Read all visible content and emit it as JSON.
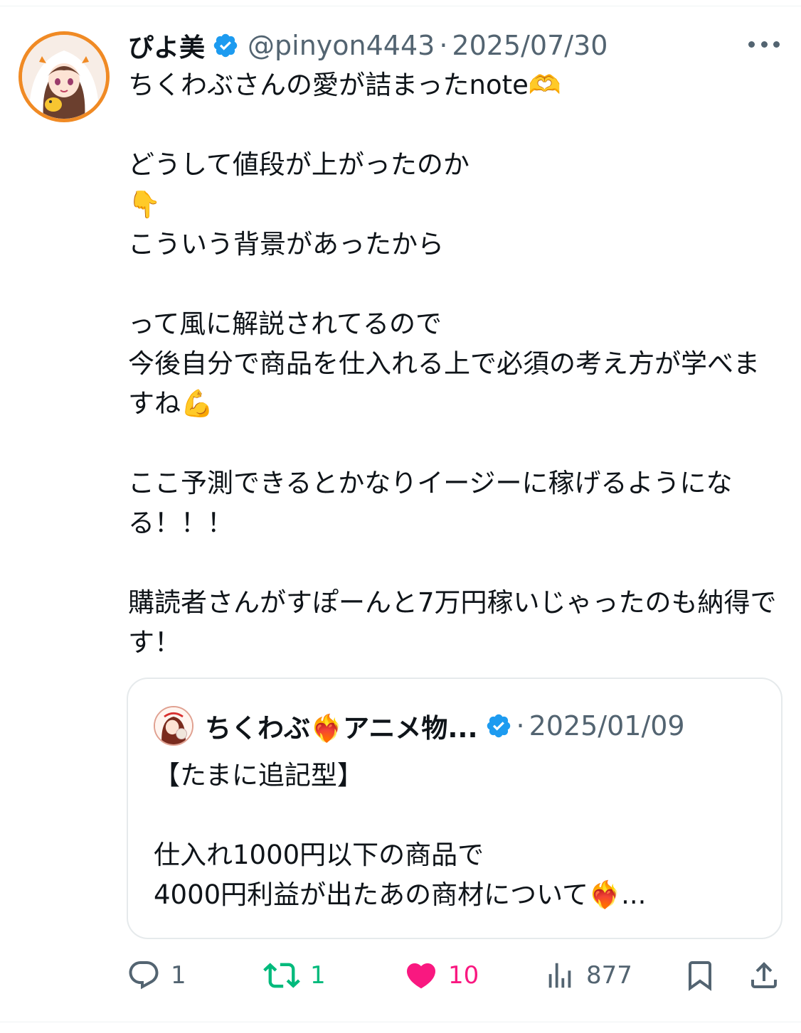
{
  "post": {
    "author": {
      "display_name": "ぴよ美",
      "handle": "@pinyon4443",
      "verified": true,
      "separator": "·",
      "date": "2025/07/30",
      "avatar_border_color": "#f08a24"
    },
    "text": "ちくわぶさんの愛が詰まったnote🫶\n\nどうして値段が上がったのか\n👇\nこういう背景があったから\n\nって風に解説されてるので\n今後自分で商品を仕入れる上で必須の考え方が学べますね💪\n\nここ予測できるとかなりイージーに稼げるようになる！！！\n\n購読者さんがすぽーんと7万円稼いじゃったのも納得です！",
    "more_icon": "more-horizontal-icon"
  },
  "quote": {
    "author": {
      "display_name": "ちくわぶ❤️‍🔥アニメ物...",
      "verified": true,
      "separator": "·",
      "date": "2025/01/09"
    },
    "text": "【たまに追記型】\n\n仕入れ1000円以下の商品で\n4000円利益が出たあの商材について❤️‍🔥..."
  },
  "actions": {
    "reply": {
      "icon": "reply-icon",
      "count": "1"
    },
    "retweet": {
      "icon": "retweet-icon",
      "count": "1",
      "color": "#00ba7c"
    },
    "like": {
      "icon": "heart-filled-icon",
      "count": "10",
      "color": "#f91880"
    },
    "views": {
      "icon": "views-chart-icon",
      "count": "877"
    },
    "bookmark": {
      "icon": "bookmark-icon"
    },
    "share": {
      "icon": "share-upload-icon"
    }
  },
  "colors": {
    "text_primary": "#0f1419",
    "text_secondary": "#536471",
    "verified_blue": "#1d9bf0"
  }
}
